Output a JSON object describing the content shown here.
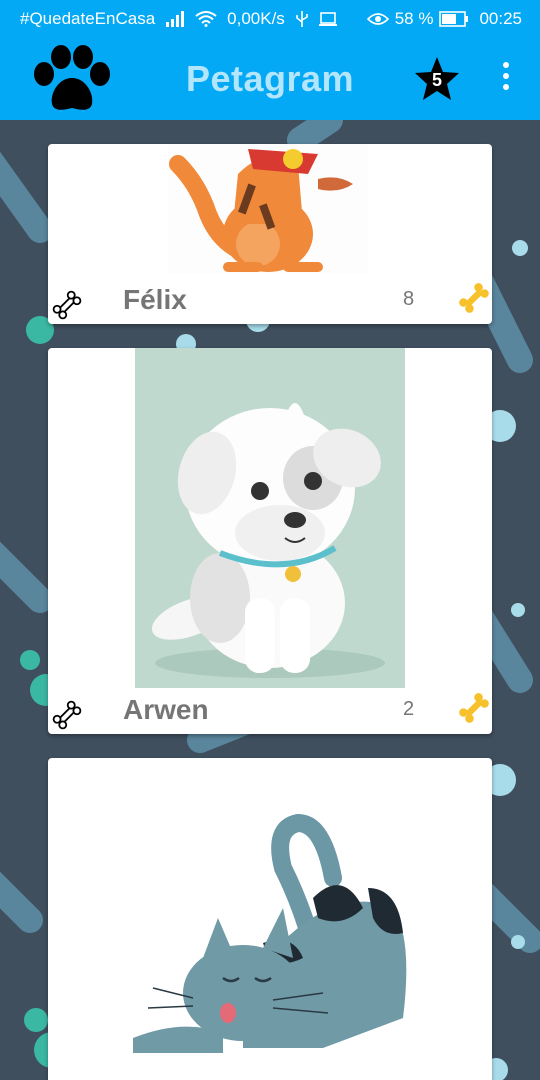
{
  "status_bar": {
    "carrier": "#QuedateEnCasa",
    "speed": "0,00K/s",
    "battery": "58 %",
    "time": "00:25"
  },
  "app_bar": {
    "title": "Petagram",
    "favorites_count": "5"
  },
  "pets": [
    {
      "name": "Félix",
      "rating": "8"
    },
    {
      "name": "Arwen",
      "rating": "2"
    },
    {
      "name": "",
      "rating": ""
    }
  ],
  "colors": {
    "primary": "#03a9f4",
    "title_text": "#b3e5fc",
    "background": "#3f4f5e",
    "bone_gold": "#f6c12b"
  }
}
